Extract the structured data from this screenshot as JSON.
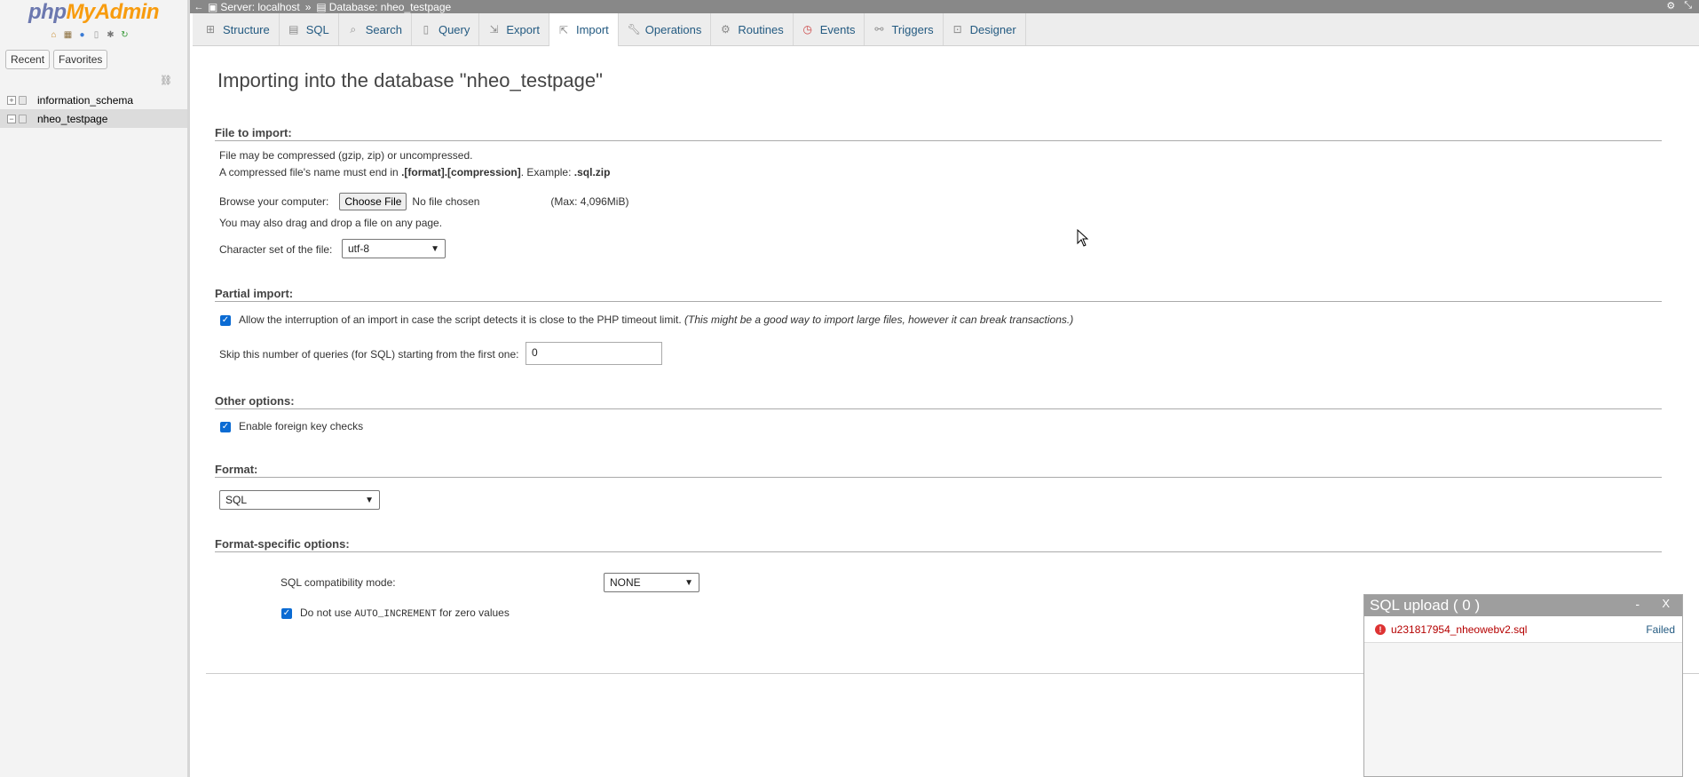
{
  "nav": {
    "logo_php": "php",
    "logo_myadmin": "MyAdmin",
    "icons": [
      "home-icon",
      "table-icon",
      "help-icon",
      "docs-icon",
      "settings-icon",
      "reload-icon"
    ],
    "tabs": [
      "Recent",
      "Favorites"
    ],
    "databases": [
      {
        "name": "information_schema",
        "active": false
      },
      {
        "name": "nheo_testpage",
        "active": true
      }
    ]
  },
  "topbar": {
    "server": "Server: localhost",
    "separator": "»",
    "database": "Database: nheo_testpage"
  },
  "tabs": [
    {
      "label": "Structure",
      "icon": "structure-icon",
      "active": false
    },
    {
      "label": "SQL",
      "icon": "sql-icon",
      "active": false
    },
    {
      "label": "Search",
      "icon": "search-icon",
      "active": false
    },
    {
      "label": "Query",
      "icon": "query-icon",
      "active": false
    },
    {
      "label": "Export",
      "icon": "export-icon",
      "active": false
    },
    {
      "label": "Import",
      "icon": "import-icon",
      "active": true
    },
    {
      "label": "Operations",
      "icon": "wrench-icon",
      "active": false
    },
    {
      "label": "Routines",
      "icon": "routines-icon",
      "active": false
    },
    {
      "label": "Events",
      "icon": "clock-icon",
      "active": false
    },
    {
      "label": "Triggers",
      "icon": "triggers-icon",
      "active": false
    },
    {
      "label": "Designer",
      "icon": "designer-icon",
      "active": false
    }
  ],
  "page": {
    "title": "Importing into the database \"nheo_testpage\"",
    "file_section": {
      "heading": "File to import:",
      "line1": "File may be compressed (gzip, zip) or uncompressed.",
      "line2_prefix": "A compressed file's name must end in ",
      "line2_bold": ".[format].[compression]",
      "line2_mid": ". Example: ",
      "line2_example": ".sql.zip",
      "browse_label": "Browse your computer:",
      "choose_button": "Choose File",
      "no_file": "No file chosen",
      "max_size": "(Max: 4,096MiB)",
      "drag_drop": "You may also drag and drop a file on any page.",
      "charset_label": "Character set of the file:",
      "charset_value": "utf-8"
    },
    "partial_section": {
      "heading": "Partial import:",
      "allow_interrupt": "Allow the interruption of an import in case the script detects it is close to the PHP timeout limit.",
      "allow_interrupt_note": "(This might be a good way to import large files, however it can break transactions.)",
      "skip_label": "Skip this number of queries (for SQL) starting from the first one:",
      "skip_value": "0"
    },
    "other_section": {
      "heading": "Other options:",
      "foreign_keys": "Enable foreign key checks"
    },
    "format_section": {
      "heading": "Format:",
      "format_value": "SQL"
    },
    "format_specific": {
      "heading": "Format-specific options:",
      "compat_label": "SQL compatibility mode:",
      "compat_value": "NONE",
      "auto_inc_prefix": "Do not use ",
      "auto_inc_code": "AUTO_INCREMENT",
      "auto_inc_suffix": " for zero values"
    }
  },
  "upload_panel": {
    "title": "SQL upload ( 0 )",
    "minimize": "-",
    "close": "X",
    "file": "u231817954_nheowebv2.sql",
    "status": "Failed"
  },
  "colors": {
    "link": "#235a81",
    "logo_php": "#6c78af",
    "logo_myadmin": "#f89c0e",
    "error": "#b50000",
    "checkbox": "#0b6bd3"
  }
}
